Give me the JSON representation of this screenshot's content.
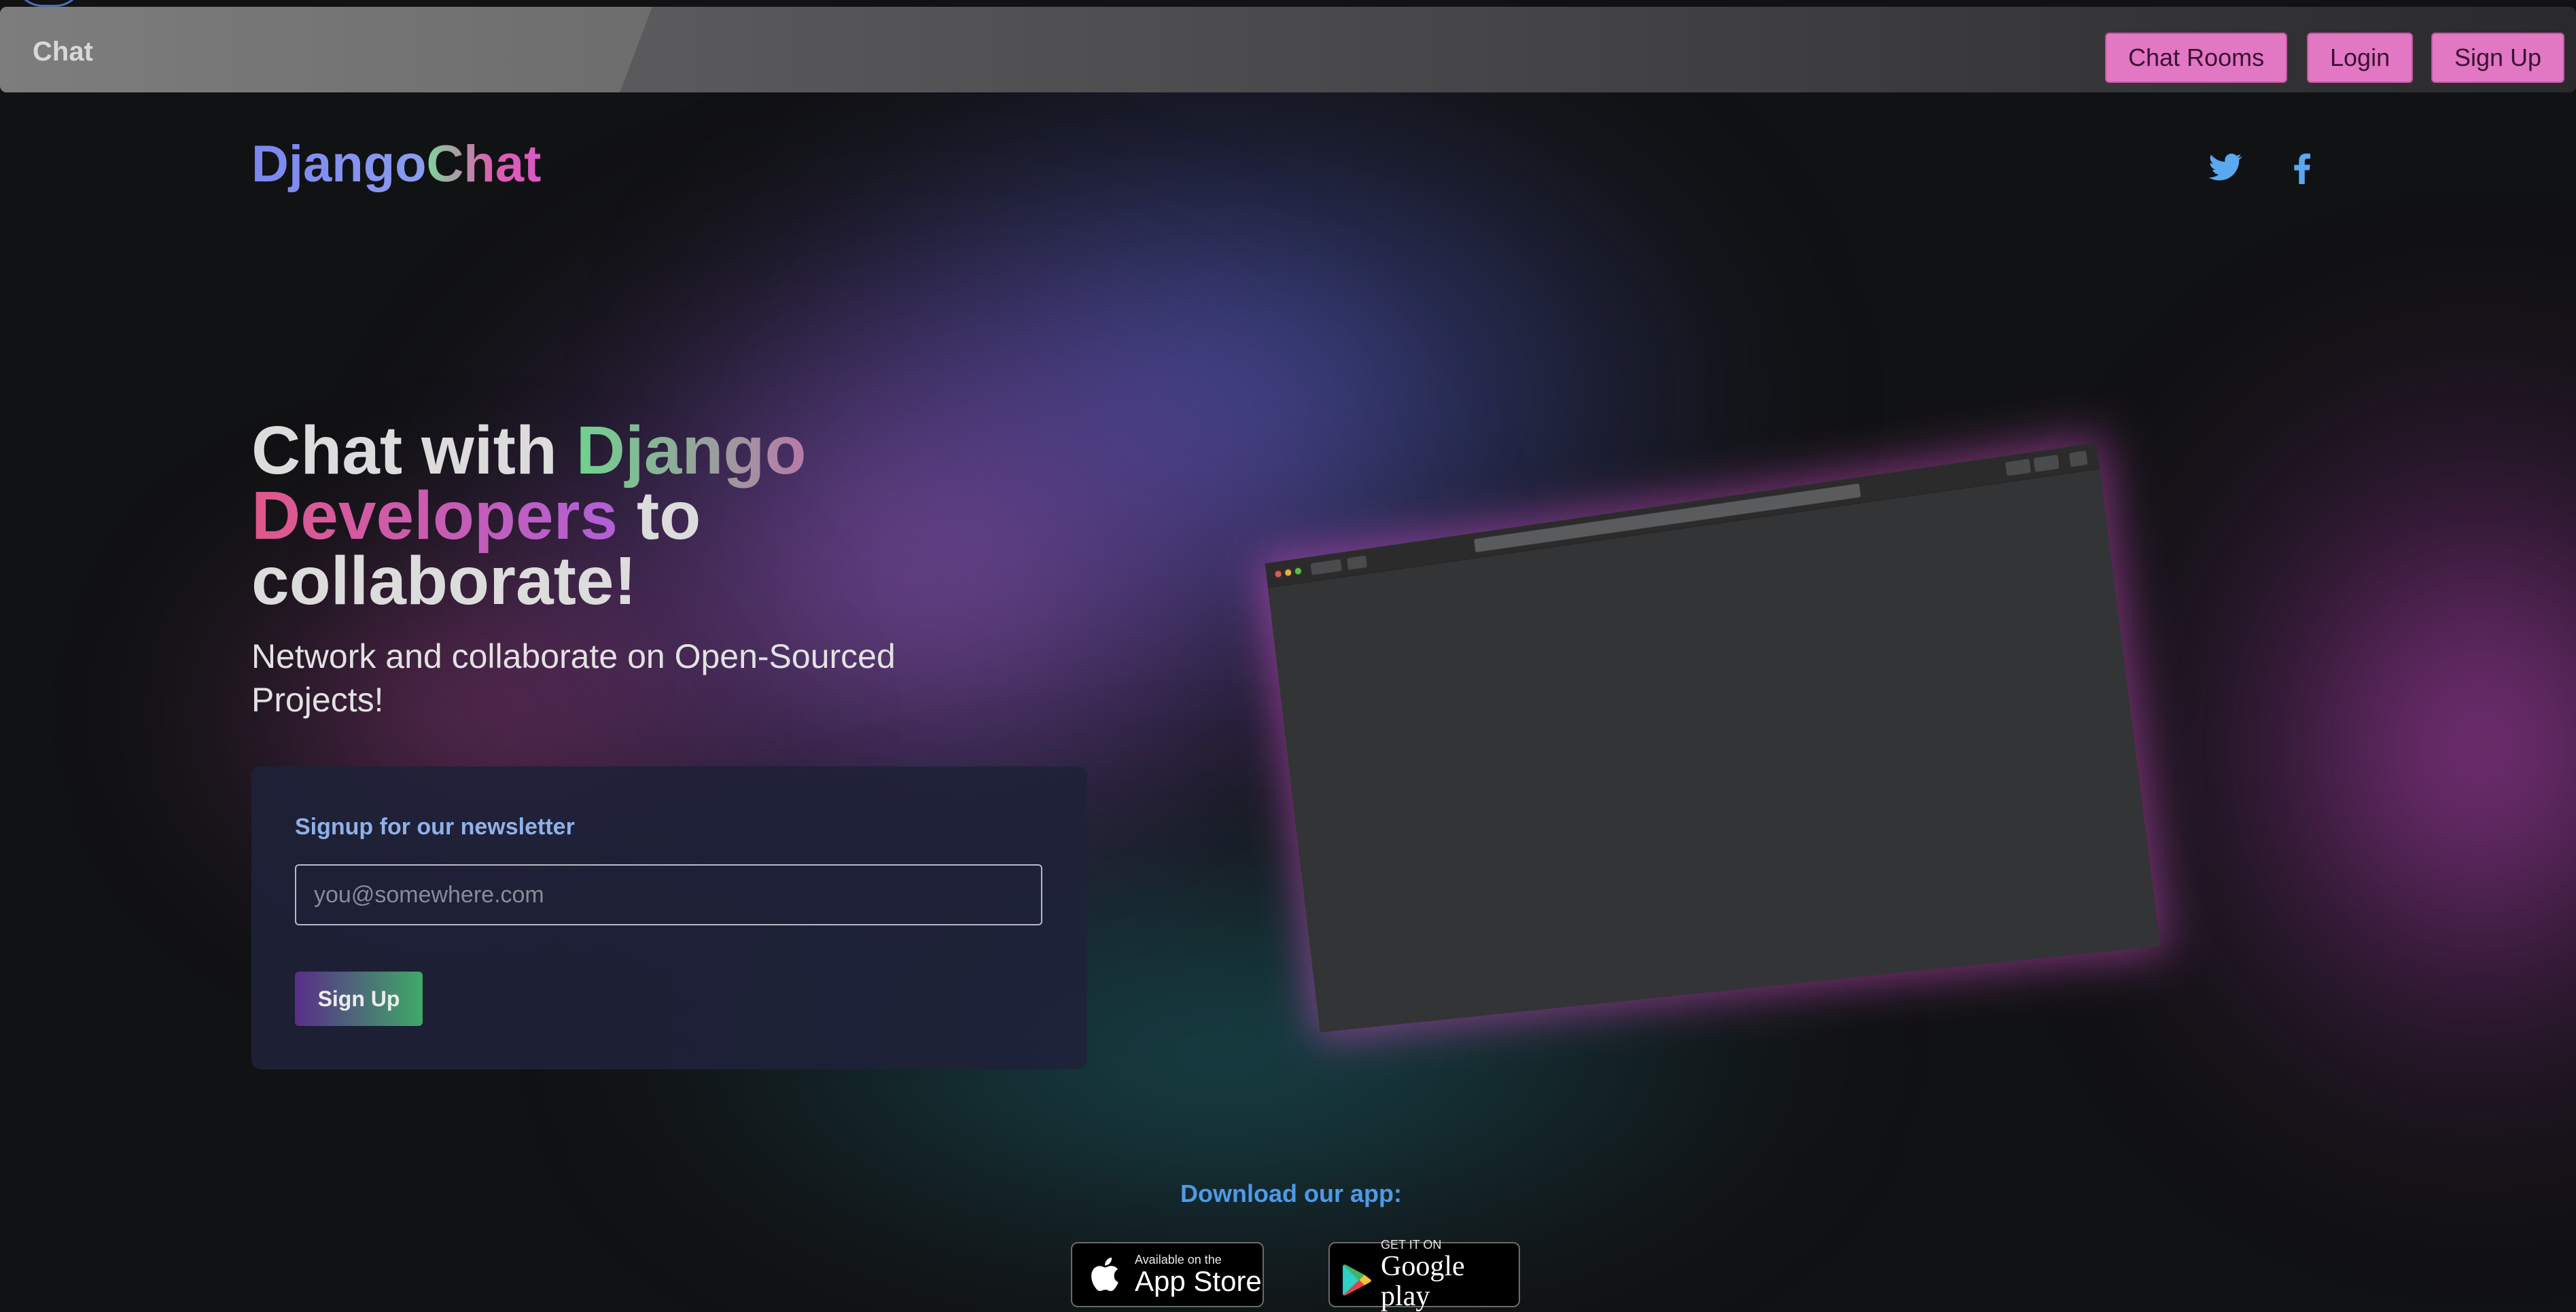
{
  "navbar": {
    "brand": "Chat",
    "buttons": {
      "chat_rooms": "Chat Rooms",
      "login": "Login",
      "sign_up": "Sign Up"
    },
    "button_color": "#e277c4"
  },
  "header": {
    "logo_part1": "Django",
    "logo_part2": "Chat",
    "social_icons": [
      "twitter-icon",
      "facebook-icon"
    ]
  },
  "hero": {
    "title_part1": "Chat with ",
    "title_part2": "Django",
    "title_part3": "Developers",
    "title_part4": " to",
    "title_part5": "collaborate!",
    "subtitle": "Network and collaborate on Open-Sourced Projects!"
  },
  "newsletter": {
    "title": "Signup for our newsletter",
    "email_placeholder": "you@somewhere.com",
    "email_value": "",
    "button": "Sign Up"
  },
  "download": {
    "label": "Download our app:",
    "appstore_small": "Available on the",
    "appstore_big": "App Store",
    "googleplay_small": "GET IT ON",
    "googleplay_big": "Google play"
  },
  "colors": {
    "accent_pink": "#e277c4",
    "link_blue": "#4d9ae8",
    "background": "#111214"
  }
}
